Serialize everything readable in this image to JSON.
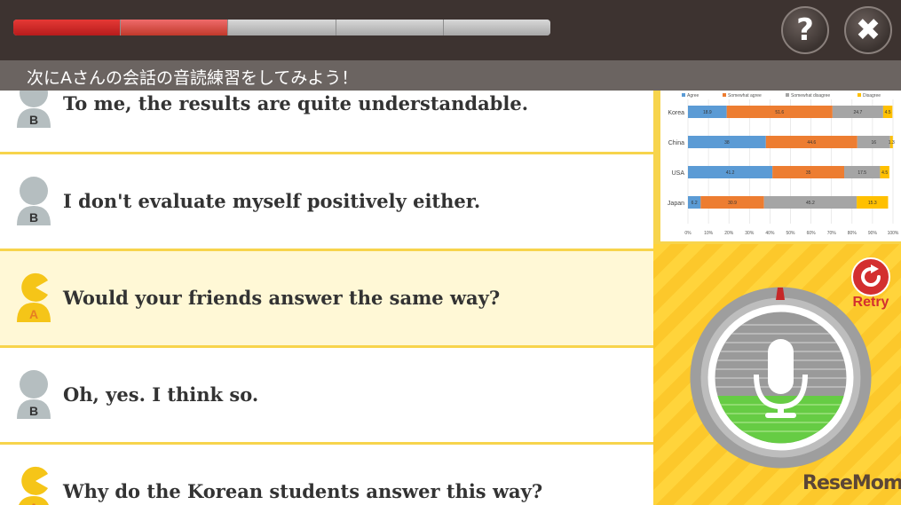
{
  "progress": {
    "segments": 5,
    "completed": 1,
    "current": 2
  },
  "header": {
    "help_icon": "question-icon",
    "close_icon": "close-icon"
  },
  "instruction": "次にAさんの会話の音読練習をしてみよう！",
  "conversation": [
    {
      "speaker": "B",
      "text": "To me, the results are quite understandable.",
      "active": false
    },
    {
      "speaker": "B",
      "text": "I don't evaluate myself positively either.",
      "active": false
    },
    {
      "speaker": "A",
      "text": "Would your friends answer the same way?",
      "active": true
    },
    {
      "speaker": "B",
      "text": "Oh, yes. I think so.",
      "active": false
    },
    {
      "speaker": "A",
      "text": "Why do the Korean students answer this way?",
      "active": false
    }
  ],
  "chart_data": {
    "type": "bar",
    "orientation": "horizontal-stacked-100",
    "categories": [
      "Korea",
      "China",
      "USA",
      "Japan"
    ],
    "series": [
      {
        "name": "Agree",
        "color": "#5b9bd5",
        "values": [
          18.9,
          38,
          41.2,
          6.2
        ]
      },
      {
        "name": "Somewhat agree",
        "color": "#ed7d31",
        "values": [
          51.6,
          44.6,
          35,
          30.9
        ]
      },
      {
        "name": "Somewhat disagree",
        "color": "#a5a5a5",
        "values": [
          24.7,
          16,
          17.5,
          45.2
        ]
      },
      {
        "name": "Disagree",
        "color": "#ffc000",
        "values": [
          4.5,
          1.3,
          4.5,
          15.3
        ]
      }
    ],
    "xticks": [
      "0%",
      "10%",
      "20%",
      "30%",
      "40%",
      "50%",
      "60%",
      "70%",
      "80%",
      "90%",
      "100%"
    ],
    "xlim": [
      0,
      100
    ],
    "legend": "top",
    "grid": true
  },
  "retry_label": "Retry",
  "mic_icon": "microphone-icon",
  "logo": "ReseMom"
}
